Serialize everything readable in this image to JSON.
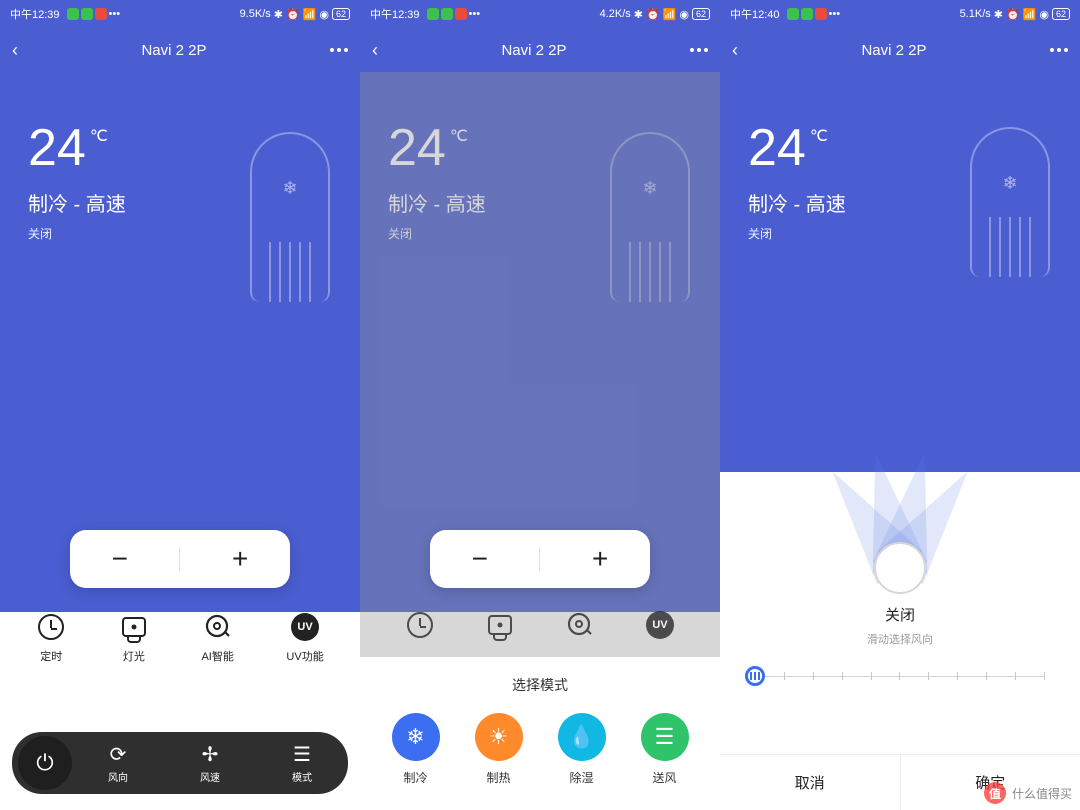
{
  "screens": [
    {
      "time": "中午12:39",
      "net": "9.5K/s",
      "battery": "62"
    },
    {
      "time": "中午12:39",
      "net": "4.2K/s",
      "battery": "62"
    },
    {
      "time": "中午12:40",
      "net": "5.1K/s",
      "battery": "62"
    }
  ],
  "device_title": "Navi 2 2P",
  "temp": "24",
  "unit": "℃",
  "mode_line": "制冷 - 高速",
  "sub_line": "关闭",
  "quick": {
    "timer": "定时",
    "light": "灯光",
    "ai": "AI智能",
    "uv": "UV功能",
    "uv_badge": "UV"
  },
  "bottom_bar": {
    "direction": "风向",
    "speed": "风速",
    "mode": "模式"
  },
  "sheet": {
    "title": "选择模式",
    "modes": [
      "制冷",
      "制热",
      "除湿",
      "送风"
    ]
  },
  "fan": {
    "state": "关闭",
    "hint": "滑动选择风向",
    "cancel": "取消",
    "confirm": "确定"
  },
  "watermark": {
    "badge": "值",
    "text": "什么值得买"
  }
}
